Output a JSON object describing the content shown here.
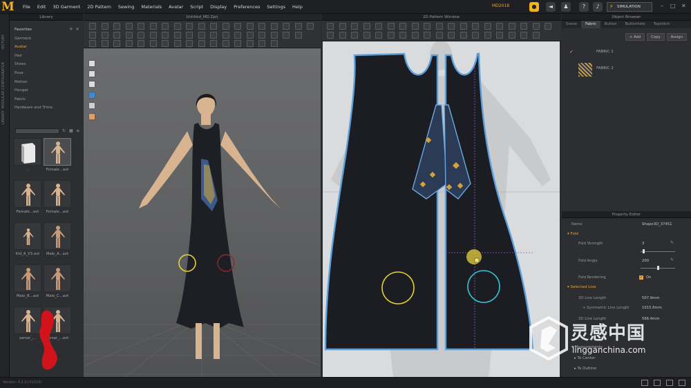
{
  "app": {
    "logo": "M",
    "menus": [
      "File",
      "Edit",
      "3D Garment",
      "2D Pattern",
      "Sewing",
      "Materials",
      "Avatar",
      "Script",
      "Display",
      "Preferences",
      "Settings",
      "Help"
    ],
    "version": "MD2018",
    "simulation_label": "SIMULATION",
    "accent": "#f2b321"
  },
  "side_strip": [
    "HISTORY",
    "MODULAR CONFIGURATOR",
    "LIBRARY"
  ],
  "library": {
    "title": "Library",
    "tree": [
      {
        "label": "Favorites",
        "state": "head"
      },
      {
        "label": "Garment",
        "state": "normal"
      },
      {
        "label": "Avatar",
        "state": "active"
      },
      {
        "label": "Hair",
        "state": "normal"
      },
      {
        "label": "Shoes",
        "state": "normal"
      },
      {
        "label": "Pose",
        "state": "normal"
      },
      {
        "label": "Motion",
        "state": "normal"
      },
      {
        "label": "Hanger",
        "state": "normal"
      },
      {
        "label": "Fabric",
        "state": "normal"
      },
      {
        "label": "Hardware and Trims",
        "state": "normal"
      }
    ],
    "thumbs": [
      {
        "label": "..",
        "kind": "folder"
      },
      {
        "label": "Female...avt",
        "kind": "female",
        "selected": true
      },
      {
        "label": "Female...avt",
        "kind": "female"
      },
      {
        "label": "Female...avt",
        "kind": "female"
      },
      {
        "label": "Kid_A_V3.avt",
        "kind": "kid"
      },
      {
        "label": "Male_A...avt",
        "kind": "male"
      },
      {
        "label": "Male_B...avt",
        "kind": "male"
      },
      {
        "label": "Male_C...avt",
        "kind": "male"
      },
      {
        "label": "sarsar_...",
        "kind": "female"
      },
      {
        "label": "sarsar_...avt",
        "kind": "female"
      }
    ]
  },
  "window3d": {
    "title": "Untitled_MD.Zprj"
  },
  "window2d": {
    "title": "2D Pattern Window"
  },
  "object_browser": {
    "title": "Object Browser",
    "tabs": [
      {
        "label": "Scene",
        "active": false
      },
      {
        "label": "Fabric",
        "active": true
      },
      {
        "label": "Button",
        "active": false
      },
      {
        "label": "Buttonhole",
        "active": false
      },
      {
        "label": "Topstitch",
        "active": false
      }
    ],
    "buttons": [
      "+ Add",
      "Copy",
      "Assign"
    ],
    "fabrics": [
      {
        "label": "FABRIC 1",
        "checked": true
      },
      {
        "label": "FABRIC 2",
        "checked": false
      }
    ]
  },
  "property_editor": {
    "title": "Property Editor",
    "name_label": "Name",
    "name_value": "Shape3D_37451",
    "fold_section": "Fold",
    "fold_strength_label": "Fold Strength",
    "fold_strength_value": "3",
    "fold_angle_label": "Fold Angle",
    "fold_angle_value": "200",
    "fold_rendering_label": "Fold Rendering",
    "fold_rendering_value": "On",
    "selected_line_section": "Selected Line",
    "line3d_label": "3D Line Length",
    "line3d_value": "507.9mm",
    "sym_label": "+ Symmetric Line Length",
    "sym_value": "1015.8mm",
    "line3d_b_label": "3D Line Length",
    "line3d_b_value": "566.4mm",
    "measurements_label": "Measurements",
    "to_center_label": "To Center",
    "to_outline_label": "To Outline"
  },
  "status": {
    "text": "Version: 4.2.2(r31020)"
  },
  "watermark": {
    "text": "灵感中国",
    "url": "lingganchina.com"
  }
}
